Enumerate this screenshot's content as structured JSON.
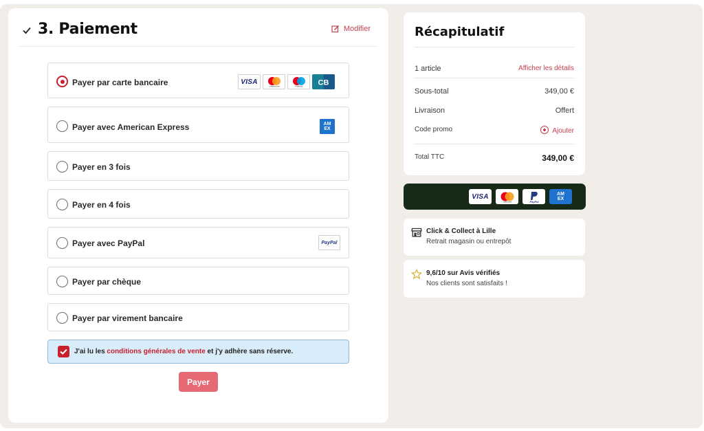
{
  "payment": {
    "title": "3. Paiement",
    "modify_label": "Modifier",
    "options": [
      {
        "label": "Payer par carte bancaire",
        "selected": true
      },
      {
        "label": "Payer avec American Express",
        "selected": false
      },
      {
        "label": "Payer en 3 fois",
        "selected": false
      },
      {
        "label": "Payer en 4 fois",
        "selected": false
      },
      {
        "label": "Payer avec PayPal",
        "selected": false
      },
      {
        "label": "Payer par chèque",
        "selected": false
      },
      {
        "label": "Payer par virement bancaire",
        "selected": false
      }
    ],
    "card_logos": [
      "VISA",
      "mastercard",
      "maestro",
      "CB"
    ],
    "amex_logo": "AM EX",
    "paypal_logo": "PayPal",
    "cgv": {
      "checked": true,
      "prefix": "J'ai lu les ",
      "link": "conditions générales de vente",
      "suffix": " et j'y adhère sans réserve."
    },
    "pay_button": "Payer"
  },
  "summary": {
    "title": "Récapitulatif",
    "items_count": "1 article",
    "details_link": "Afficher les détails",
    "subtotal_label": "Sous-total",
    "subtotal_value": "349,00 €",
    "shipping_label": "Livraison",
    "shipping_value": "Offert",
    "promo_label": "Code promo",
    "promo_add": "Ajouter",
    "total_label": "Total TTC",
    "total_value": "349,00 €"
  },
  "accepted_cards": [
    "VISA",
    "mastercard",
    "PayPal",
    "AM EX"
  ],
  "click_collect": {
    "title": "Click & Collect à Lille",
    "subtitle": "Retrait magasin ou entrepôt"
  },
  "reviews": {
    "title": "9,6/10 sur Avis vérifiés",
    "subtitle": "Nos clients sont satisfaits !"
  },
  "colors": {
    "accent": "#c8202e",
    "pay_button": "#e56a74",
    "cards_bar": "#162a17",
    "background": "#f1eee9"
  }
}
